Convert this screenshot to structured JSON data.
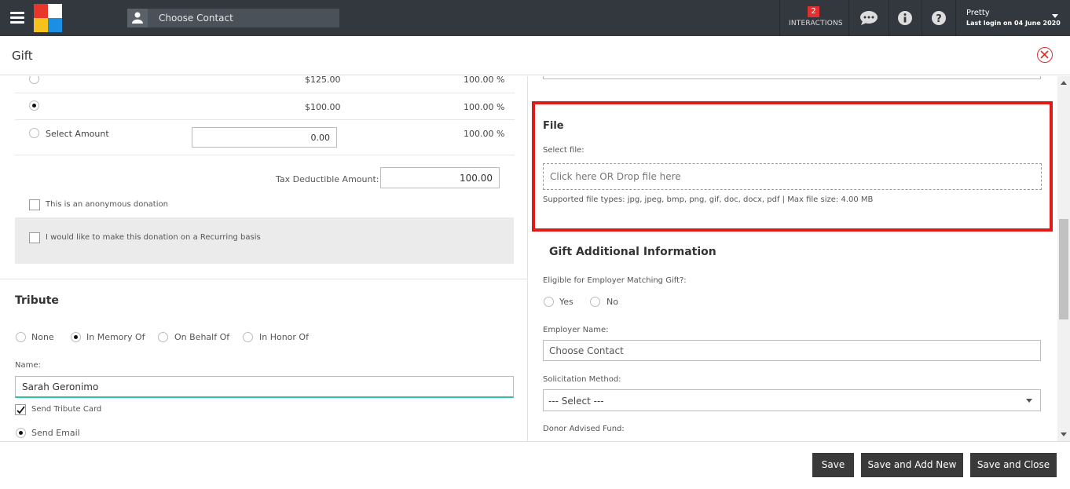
{
  "topbar": {
    "contact_placeholder": "Choose Contact",
    "interactions_count": "2",
    "interactions_label": "INTERACTIONS",
    "user_name": "Pretty",
    "last_login": "Last login on 04 June 2020"
  },
  "header": {
    "title": "Gift"
  },
  "amounts": {
    "row1": {
      "amount": "$125.00",
      "percent": "100.00 %"
    },
    "row2": {
      "amount": "$100.00",
      "percent": "100.00 %"
    },
    "row3": {
      "label": "Select Amount",
      "value": "0.00",
      "percent": "100.00 %"
    },
    "tax_label": "Tax Deductible Amount:",
    "tax_value": "100.00",
    "anonymous_label": "This is an anonymous donation",
    "recurring_label": "I would like to make this donation on a Recurring basis"
  },
  "tribute": {
    "title": "Tribute",
    "options": [
      "None",
      "In Memory Of",
      "On Behalf Of",
      "In Honor Of"
    ],
    "name_label": "Name:",
    "name_value": "Sarah Geronimo",
    "send_card_label": "Send Tribute Card",
    "send_email_label": "Send Email"
  },
  "file": {
    "title": "File",
    "select_label": "Select file:",
    "drop_text": "Click here OR Drop file here",
    "supported": "Supported file types: jpg, jpeg, bmp, png, gif, doc, docx, pdf | Max file size: 4.00 MB"
  },
  "additional": {
    "title": "Gift Additional Information",
    "employer_match_label": "Eligible for Employer Matching Gift?:",
    "yes": "Yes",
    "no": "No",
    "employer_name_label": "Employer Name:",
    "employer_placeholder": "Choose Contact",
    "solicitation_label": "Solicitation Method:",
    "solicitation_value": "--- Select ---",
    "donor_fund_label": "Donor Advised Fund:"
  },
  "footer": {
    "save": "Save",
    "save_add_new": "Save and Add New",
    "save_close": "Save and Close"
  },
  "colors": {
    "topbar": "#32383e",
    "highlight": "#e01919",
    "button": "#3a3a3a",
    "focus_underline": "#2ec4a0"
  }
}
